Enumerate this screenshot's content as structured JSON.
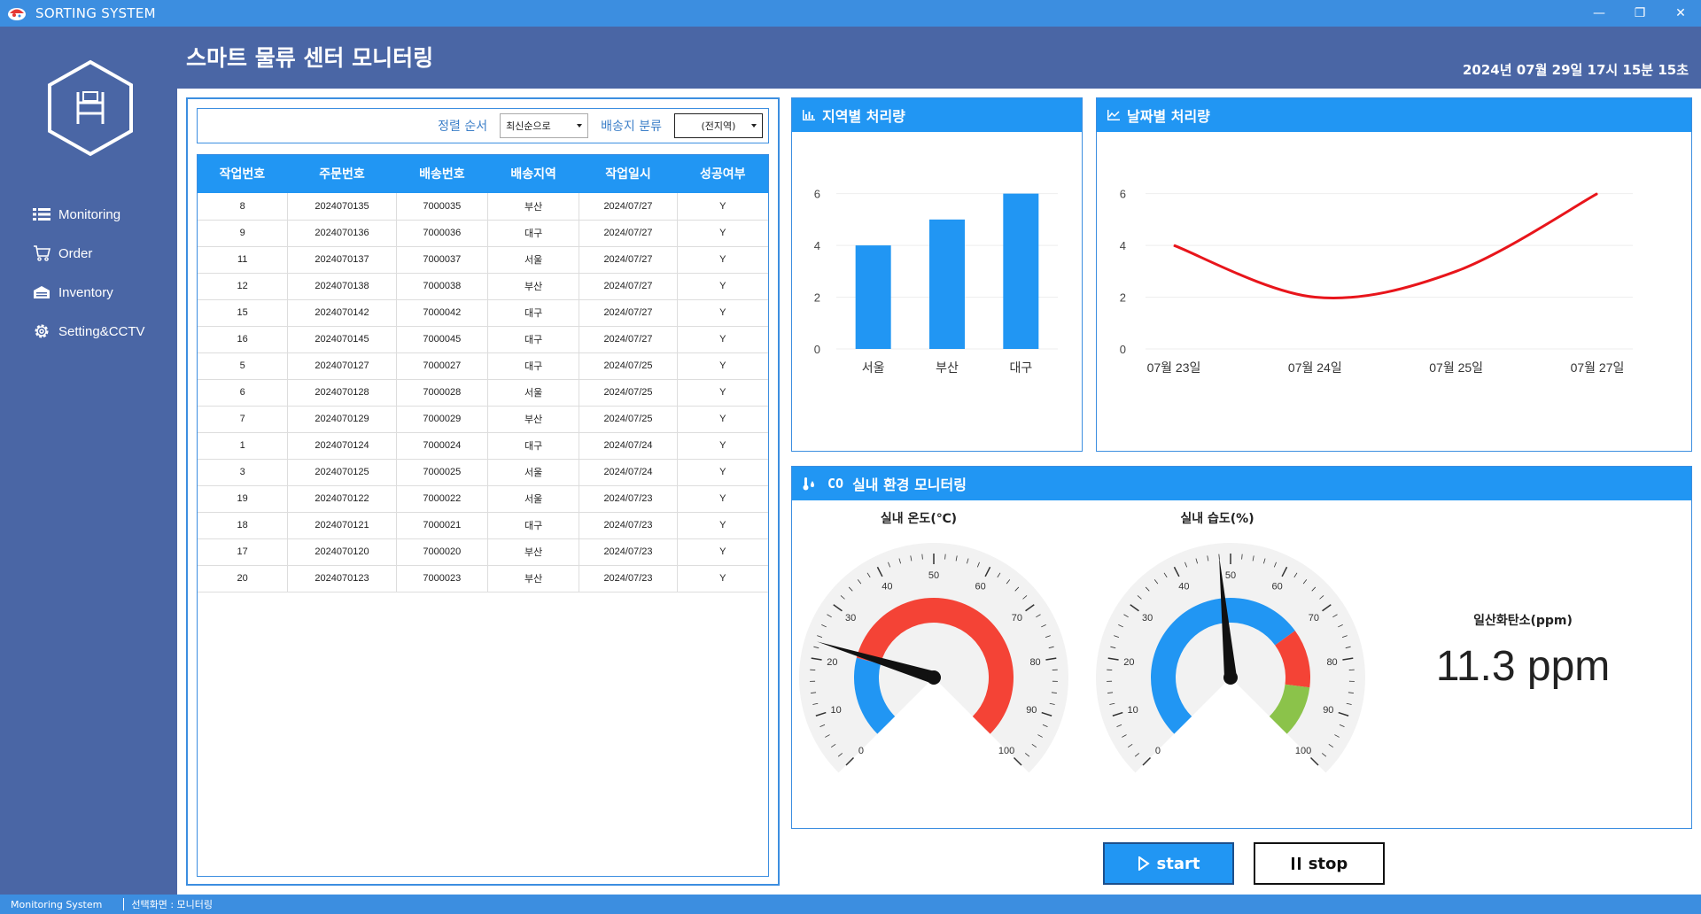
{
  "window": {
    "title": "SORTING SYSTEM",
    "controls": [
      "—",
      "❐",
      "✕"
    ]
  },
  "sidebar": {
    "items": [
      {
        "label": "Monitoring",
        "icon": "list-icon"
      },
      {
        "label": "Order",
        "icon": "cart-icon"
      },
      {
        "label": "Inventory",
        "icon": "warehouse-icon"
      },
      {
        "label": "Setting&CCTV",
        "icon": "gear-icon"
      }
    ]
  },
  "header": {
    "title": "스마트 물류 센터 모니터링",
    "datetime": "2024년 07월 29일 17시 15분 15초"
  },
  "filters": {
    "order_label": "정렬 순서",
    "order_value": "최신순으로",
    "region_label": "배송지 분류",
    "region_value": "(전지역)"
  },
  "table": {
    "columns": [
      "작업번호",
      "주문번호",
      "배송번호",
      "배송지역",
      "작업일시",
      "성공여부"
    ],
    "rows": [
      [
        "8",
        "2024070135",
        "7000035",
        "부산",
        "2024/07/27",
        "Y"
      ],
      [
        "9",
        "2024070136",
        "7000036",
        "대구",
        "2024/07/27",
        "Y"
      ],
      [
        "11",
        "2024070137",
        "7000037",
        "서울",
        "2024/07/27",
        "Y"
      ],
      [
        "12",
        "2024070138",
        "7000038",
        "부산",
        "2024/07/27",
        "Y"
      ],
      [
        "15",
        "2024070142",
        "7000042",
        "대구",
        "2024/07/27",
        "Y"
      ],
      [
        "16",
        "2024070145",
        "7000045",
        "대구",
        "2024/07/27",
        "Y"
      ],
      [
        "5",
        "2024070127",
        "7000027",
        "대구",
        "2024/07/25",
        "Y"
      ],
      [
        "6",
        "2024070128",
        "7000028",
        "서울",
        "2024/07/25",
        "Y"
      ],
      [
        "7",
        "2024070129",
        "7000029",
        "부산",
        "2024/07/25",
        "Y"
      ],
      [
        "1",
        "2024070124",
        "7000024",
        "대구",
        "2024/07/24",
        "Y"
      ],
      [
        "3",
        "2024070125",
        "7000025",
        "서울",
        "2024/07/24",
        "Y"
      ],
      [
        "19",
        "2024070122",
        "7000022",
        "서울",
        "2024/07/23",
        "Y"
      ],
      [
        "18",
        "2024070121",
        "7000021",
        "대구",
        "2024/07/23",
        "Y"
      ],
      [
        "17",
        "2024070120",
        "7000020",
        "부산",
        "2024/07/23",
        "Y"
      ],
      [
        "20",
        "2024070123",
        "7000023",
        "부산",
        "2024/07/23",
        "Y"
      ]
    ]
  },
  "panels": {
    "region_title": "지역별 처리량",
    "date_title": "날짜별 처리량",
    "env_title": "실내 환경 모니터링",
    "env_icon_text": "CO"
  },
  "chart_data": [
    {
      "type": "bar",
      "title": "지역별 처리량",
      "categories": [
        "서울",
        "부산",
        "대구"
      ],
      "values": [
        4,
        5,
        6
      ],
      "ylim": [
        0,
        6.5
      ],
      "yticks": [
        0,
        2,
        4,
        6
      ],
      "color": "#2196f3",
      "grid": true
    },
    {
      "type": "line",
      "title": "날짜별 처리량",
      "categories": [
        "07월 23일",
        "07월 24일",
        "07월 25일",
        "07월 27일"
      ],
      "values": [
        4,
        2,
        3,
        6
      ],
      "ylim": [
        0,
        6.5
      ],
      "yticks": [
        0,
        2,
        4,
        6
      ],
      "color": "#e8151b",
      "grid": true
    }
  ],
  "environment": {
    "temperature": {
      "label": "실내 온도(℃)",
      "value": 23,
      "min": 0,
      "max": 100,
      "major_ticks": [
        "0",
        "10",
        "20",
        "30",
        "40",
        "50",
        "60",
        "70",
        "80",
        "90",
        "100"
      ],
      "ranges": [
        {
          "from": 0,
          "to": 22,
          "color": "#2196f3"
        },
        {
          "from": 22,
          "to": 100,
          "color": "#f44336"
        }
      ]
    },
    "humidity": {
      "label": "실내 습도(%)",
      "value": 48,
      "min": 0,
      "max": 100,
      "major_ticks": [
        "0",
        "10",
        "20",
        "30",
        "40",
        "50",
        "60",
        "70",
        "80",
        "90",
        "100"
      ],
      "ranges": [
        {
          "from": 0,
          "to": 70,
          "color": "#2196f3"
        },
        {
          "from": 70,
          "to": 86,
          "color": "#f44336"
        },
        {
          "from": 86,
          "to": 100,
          "color": "#8bc34a"
        }
      ]
    },
    "co": {
      "label": "일산화탄소(ppm)",
      "value": "11.3 ppm"
    }
  },
  "buttons": {
    "start": "start",
    "stop": "stop"
  },
  "statusbar": {
    "system": "Monitoring System",
    "screen": "선택화면 : 모니터링"
  },
  "colors": {
    "accent": "#2196f3",
    "titlebar": "#3c8ee0",
    "sidebar": "#4a66a5",
    "line": "#e8151b",
    "danger": "#f44336",
    "ok": "#8bc34a"
  }
}
